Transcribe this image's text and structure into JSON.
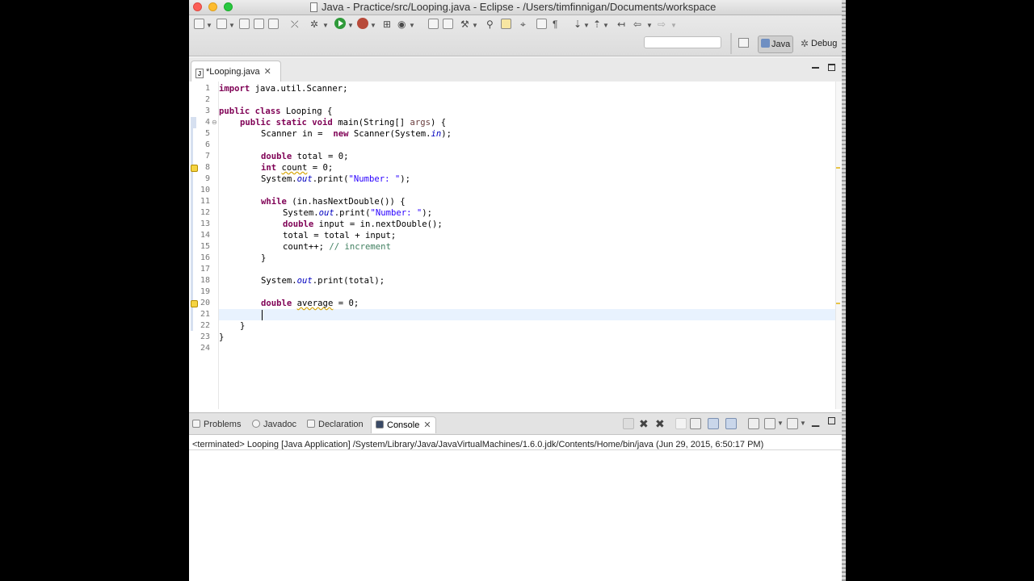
{
  "window": {
    "title": "Java - Practice/src/Looping.java - Eclipse - /Users/timfinnigan/Documents/workspace"
  },
  "perspectives": {
    "java_label": "Java",
    "debug_label": "Debug"
  },
  "quick_access": {
    "placeholder": ""
  },
  "editor": {
    "tab_label": "*Looping.java",
    "tab_icon": "java-file-icon",
    "line_numbers": [
      "1",
      "2",
      "3",
      "4",
      "5",
      "6",
      "7",
      "8",
      "9",
      "10",
      "11",
      "12",
      "13",
      "14",
      "15",
      "16",
      "17",
      "18",
      "19",
      "20",
      "21",
      "22",
      "23",
      "24"
    ],
    "code": {
      "l1_kw": "import",
      "l1_rest": " java.util.Scanner;",
      "l3_kw": "public class",
      "l3_rest": " Looping {",
      "l4_kw": "public static void",
      "l4_rest": " main(String[] ",
      "l4_arg": "args",
      "l4_end": ") {",
      "l5_a": "Scanner ",
      "l5_in": "in",
      "l5_b": " =  ",
      "l5_kw": "new",
      "l5_c": " Scanner(System.",
      "l5_st": "in",
      "l5_d": ");",
      "l7_kw": "double",
      "l7_var": " total",
      "l7_rest": " = 0;",
      "l8_kw": "int",
      "l8_sp": " ",
      "l8_var": "count",
      "l8_rest": " = 0;",
      "l9_a": "System.",
      "l9_st": "out",
      "l9_b": ".print(",
      "l9_str": "\"Number: \"",
      "l9_c": ");",
      "l11_kw": "while",
      "l11_rest": " (in.hasNextDouble()) {",
      "l12_a": "System.",
      "l12_st": "out",
      "l12_b": ".print(",
      "l12_str": "\"Number: \"",
      "l12_c": ");",
      "l13_kw": "double",
      "l13_rest": " input = in.nextDouble();",
      "l14": "total = total + input;",
      "l15_a": "count++; ",
      "l15_cm": "// increment",
      "l16": "}",
      "l18_a": "System.",
      "l18_st": "out",
      "l18_b": ".print(total);",
      "l20_kw": "double",
      "l20_sp": " ",
      "l20_var": "average",
      "l20_rest": " = 0;",
      "l22": "}",
      "l23": "}"
    },
    "current_line": 21
  },
  "bottom_panel": {
    "tabs": [
      {
        "label": "Problems",
        "icon": "problems-icon"
      },
      {
        "label": "Javadoc",
        "icon": "javadoc-icon"
      },
      {
        "label": "Declaration",
        "icon": "declaration-icon"
      },
      {
        "label": "Console",
        "icon": "console-icon",
        "active": true
      }
    ],
    "console_status": "<terminated> Looping [Java Application] /System/Library/Java/JavaVirtualMachines/1.6.0.jdk/Contents/Home/bin/java (Jun 29, 2015, 6:50:17 PM)"
  },
  "colors": {
    "keyword": "#7f0055",
    "string": "#2a00ff",
    "comment": "#3f7f5f",
    "static_field": "#0000c0",
    "current_line": "#e8f2fe"
  }
}
